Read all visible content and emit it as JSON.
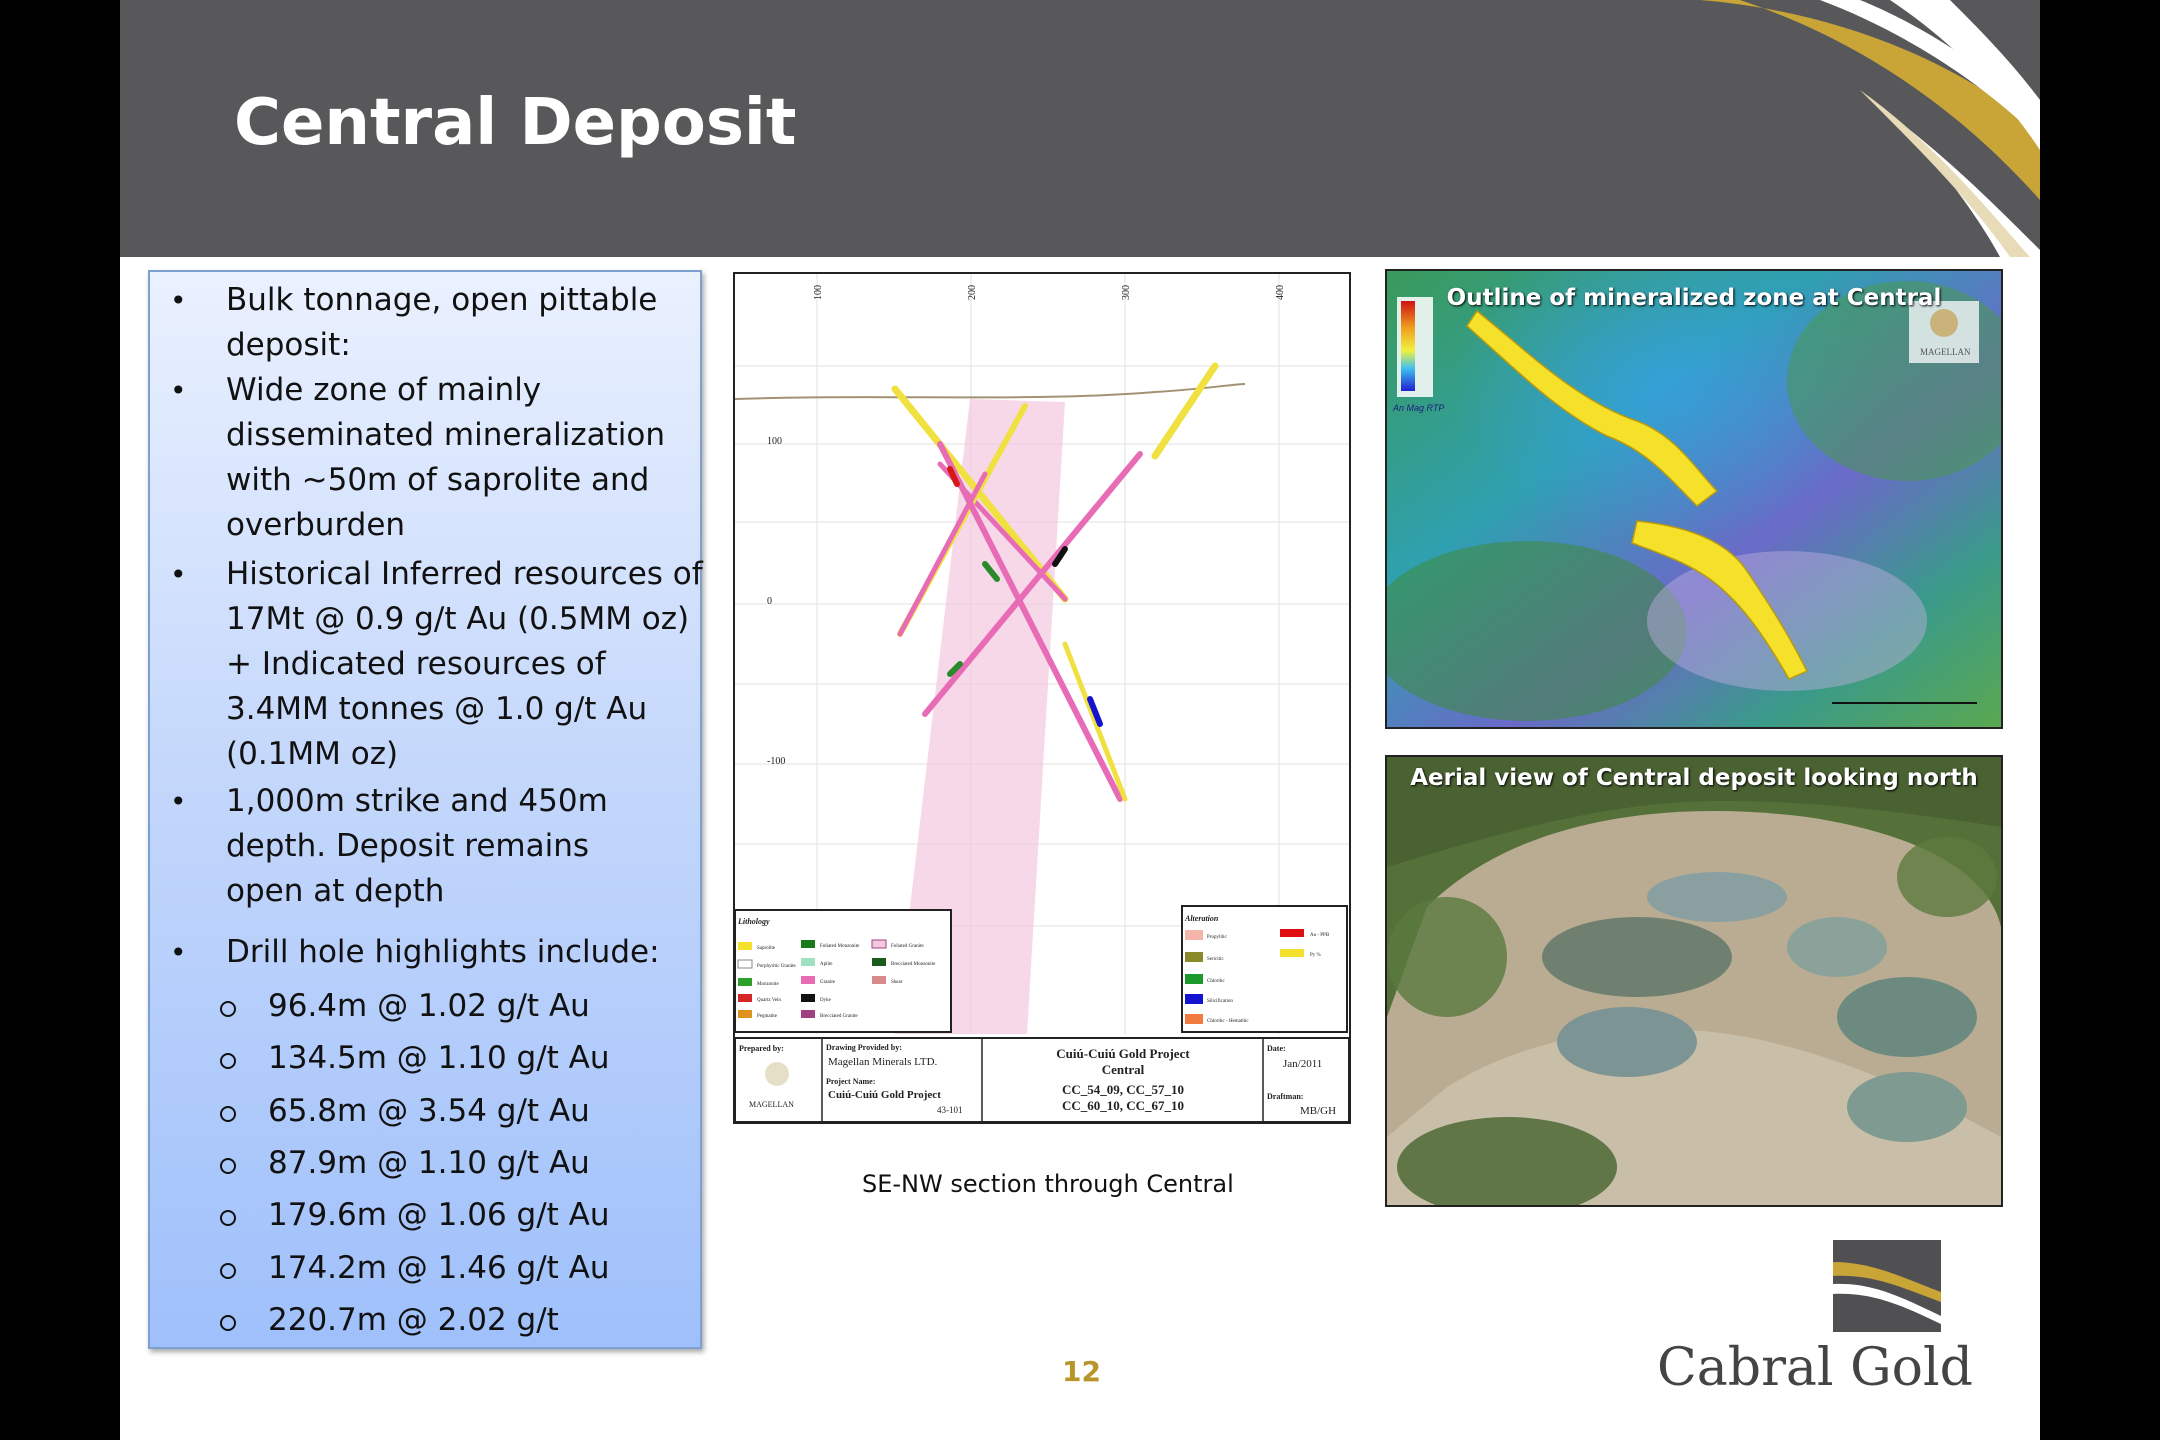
{
  "header": {
    "title": "Central Deposit"
  },
  "bullets": [
    {
      "lines": [
        "Bulk tonnage, open pittable",
        "deposit:"
      ]
    },
    {
      "lines": [
        "Wide zone of mainly",
        "disseminated mineralization",
        "with ~50m of saprolite and",
        "overburden"
      ]
    },
    {
      "lines": [
        "Historical Inferred resources of",
        "17Mt @ 0.9 g/t Au (0.5MM oz)",
        "+ Indicated resources of",
        "3.4MM tonnes @ 1.0 g/t Au",
        "(0.1MM oz)"
      ]
    },
    {
      "lines": [
        "1,000m strike and 450m",
        "depth. Deposit remains",
        "open at depth"
      ]
    },
    {
      "lines": [
        "Drill hole highlights include:"
      ]
    }
  ],
  "highlights": [
    "96.4m @ 1.02 g/t Au",
    "134.5m @ 1.10 g/t Au",
    "65.8m @ 3.54 g/t Au",
    "87.9m @ 1.10 g/t Au",
    "179.6m @ 1.06 g/t Au",
    "174.2m @ 1.46 g/t Au",
    "220.7m @ 2.02 g/t"
  ],
  "section": {
    "caption": "SE-NW section through Central",
    "top_ticks": [
      "100",
      "200",
      "300",
      "400"
    ],
    "side_ticks": [
      "100",
      "0",
      "-100"
    ],
    "legend_lithology_title": "Lithology",
    "legend_alteration_title": "Alteration",
    "lithology_items": [
      "Saprolite",
      "Porphyritic Granite",
      "Monzonite",
      "Quartz Vein",
      "Pegmatite",
      "Foliated Monzonite",
      "Aplite",
      "Granite",
      "Dyke",
      "Brecciated Granite",
      "Foliated Granite",
      "Brecciated Monzonite",
      "Shear"
    ],
    "alteration_items": [
      "Propylitic",
      "Sericitic",
      "Chloritic",
      "Silicification",
      "Chloritic - Hematitic",
      "Au - PPB",
      "Py %"
    ],
    "title_block": {
      "prepared_by_label": "Prepared by:",
      "drawing_label": "Drawing Provided by:",
      "drawing_value": "Magellan Minerals LTD.",
      "project_label": "Project Name:",
      "project_value": "Cuiú-Cuiú Gold Project",
      "project_num": "43-101",
      "logo_label": "MAGELLAN",
      "center_title": "Cuiú-Cuiú Gold Project",
      "center_sub": "Central",
      "holes_line1": "CC_54_09, CC_57_10",
      "holes_line2": "CC_60_10, CC_67_10",
      "date_label": "Date:",
      "date_value": "Jan/2011",
      "draftsman_label": "Draftman:",
      "draftsman_value": "MB/GH"
    }
  },
  "photo_top": {
    "title": "Outline of mineralized zone at Central",
    "legend_label": "An Mag RTP",
    "logo_label": "MAGELLAN"
  },
  "photo_bottom": {
    "title": "Aerial view of Central deposit looking north"
  },
  "footer": {
    "page_number": "12",
    "logo_text": "Cabral Gold"
  },
  "colors": {
    "header_bg": "#58585a",
    "gold": "#b8952b",
    "panel_border": "#7ea0cf"
  }
}
